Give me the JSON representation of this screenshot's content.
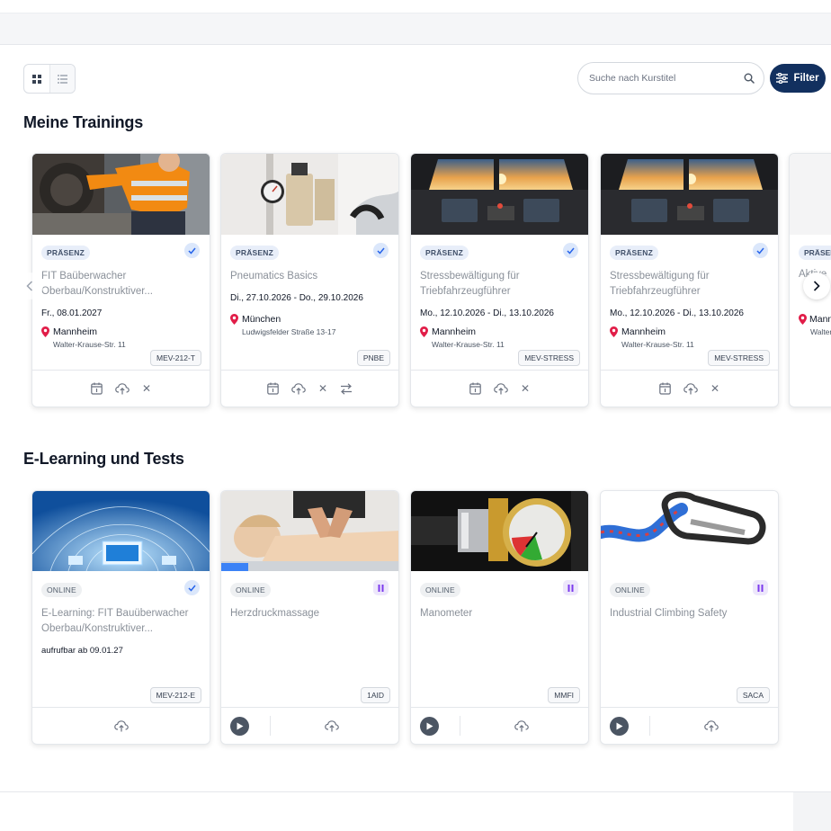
{
  "toolbar": {
    "view_grid_icon": "grid-icon",
    "view_list_icon": "list-icon",
    "search_placeholder": "Suche nach Kurstitel",
    "filter_label": "Filter"
  },
  "sections": {
    "trainings_title": "Meine Trainings",
    "elearning_title": "E-Learning und Tests"
  },
  "trainings": [
    {
      "badge": "PRÄSENZ",
      "title": "FIT Baüberwacher Oberbau/Konstruktiver...",
      "date": "Fr., 08.01.2027",
      "city": "Mannheim",
      "street": "Walter-Krause-Str. 11",
      "code": "MEV-212-T",
      "status": "check"
    },
    {
      "badge": "PRÄSENZ",
      "title": "Pneumatics Basics",
      "date": "Di., 27.10.2026 - Do., 29.10.2026",
      "city": "München",
      "street": "Ludwigsfelder Straße 13-17",
      "code": "PNBE",
      "status": "check"
    },
    {
      "badge": "PRÄSENZ",
      "title": "Stressbewältigung für Triebfahrzeugführer",
      "date": "Mo., 12.10.2026 - Di., 13.10.2026",
      "city": "Mannheim",
      "street": "Walter-Krause-Str. 11",
      "code": "MEV-STRESS",
      "status": "check"
    },
    {
      "badge": "PRÄSENZ",
      "title": "Stressbewältigung für Triebfahrzeugführer",
      "date": "Mo., 12.10.2026 - Di., 13.10.2026",
      "city": "Mannheim",
      "street": "Walter-Krause-Str. 11",
      "code": "MEV-STRESS",
      "status": "check"
    }
  ],
  "partial_card": {
    "badge": "PRÄSEN",
    "title": "Aktive",
    "city": "Mann",
    "street": "Walter"
  },
  "elearnings": [
    {
      "badge": "ONLINE",
      "title": "E-Learning: FIT Bauüberwacher Oberbau/Konstruktiver...",
      "date": "aufrufbar ab 09.01.27",
      "code": "MEV-212-E",
      "status": "check"
    },
    {
      "badge": "ONLINE",
      "title": "Herzdruckmassage",
      "date": "",
      "code": "1AID",
      "status": "pause"
    },
    {
      "badge": "ONLINE",
      "title": "Manometer",
      "date": "",
      "code": "MMFI",
      "status": "pause"
    },
    {
      "badge": "ONLINE",
      "title": "Industrial Climbing Safety",
      "date": "",
      "code": "SACA",
      "status": "pause"
    }
  ],
  "colors": {
    "primary": "#12305f",
    "location_pin": "#e11d48",
    "check_bg": "#dbe7fb",
    "pause_bg": "#ede7fb"
  }
}
